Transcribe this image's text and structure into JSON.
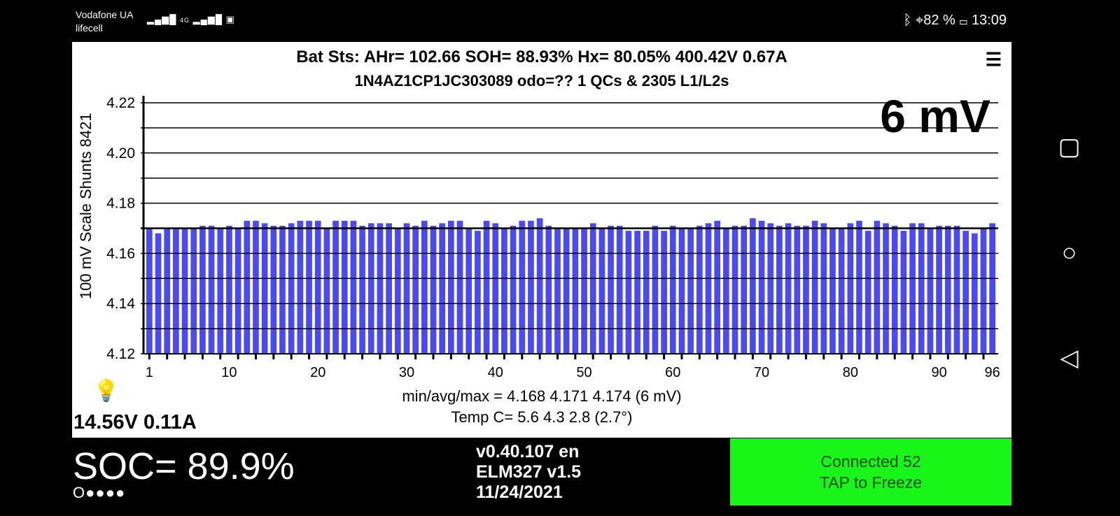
{
  "status_bar": {
    "carrier1": "Vodafone UA",
    "carrier2": "lifecell",
    "signal": "4G",
    "battery": "82 %",
    "time": "13:09"
  },
  "header": {
    "line1": "Bat Sts:  AHr= 102.66  SOH= 88.93%   Hx= 80.05%   400.42V 0.67A",
    "line2": "1N4AZ1CP1JC303089 odo=??  1 QCs & 2305 L1/L2s",
    "menu_icon": "menu-icon",
    "spread": "6 mV"
  },
  "chart_data": {
    "type": "bar",
    "ylabel": "100 mV Scale   Shunts 8421",
    "ylim": [
      4.12,
      4.22
    ],
    "yticks": [
      "4.12",
      "4.14",
      "4.16",
      "4.18",
      "4.20",
      "4.22"
    ],
    "xticks": [
      "1",
      "10",
      "20",
      "30",
      "40",
      "50",
      "60",
      "70",
      "80",
      "90",
      "96"
    ],
    "grid": true,
    "bar_color": "#4a4af0",
    "values": [
      4.17,
      4.168,
      4.17,
      4.17,
      4.17,
      4.17,
      4.171,
      4.171,
      4.17,
      4.171,
      4.17,
      4.173,
      4.173,
      4.172,
      4.171,
      4.171,
      4.172,
      4.173,
      4.173,
      4.173,
      4.17,
      4.173,
      4.173,
      4.173,
      4.171,
      4.172,
      4.172,
      4.172,
      4.17,
      4.172,
      4.171,
      4.173,
      4.171,
      4.172,
      4.173,
      4.173,
      4.17,
      4.169,
      4.173,
      4.172,
      4.17,
      4.171,
      4.173,
      4.173,
      4.174,
      4.171,
      4.17,
      4.17,
      4.17,
      4.17,
      4.172,
      4.17,
      4.171,
      4.171,
      4.169,
      4.169,
      4.169,
      4.171,
      4.169,
      4.171,
      4.17,
      4.17,
      4.171,
      4.172,
      4.173,
      4.17,
      4.171,
      4.171,
      4.174,
      4.173,
      4.172,
      4.171,
      4.172,
      4.171,
      4.171,
      4.173,
      4.172,
      4.17,
      4.17,
      4.172,
      4.173,
      4.169,
      4.173,
      4.172,
      4.171,
      4.169,
      4.172,
      4.172,
      4.17,
      4.171,
      4.171,
      4.171,
      4.169,
      4.168,
      4.17,
      4.172
    ]
  },
  "stats": {
    "minavgmax": "min/avg/max = 4.168 4.171 4.174  (6 mV)",
    "temp": "Temp C= 5.6  4.3  2.8  (2.7°)"
  },
  "aux": {
    "voltage": "14.56V 0.11A",
    "bulb_icon": "lightbulb-icon"
  },
  "bottom": {
    "soc": "SOC= 89.9%",
    "dots": "O●●●●",
    "version": "v0.40.107 en",
    "elm": "ELM327 v1.5",
    "date": "11/24/2021",
    "connected": "Connected 52",
    "tap": "TAP to Freeze",
    "connected_color": "#19f519"
  }
}
